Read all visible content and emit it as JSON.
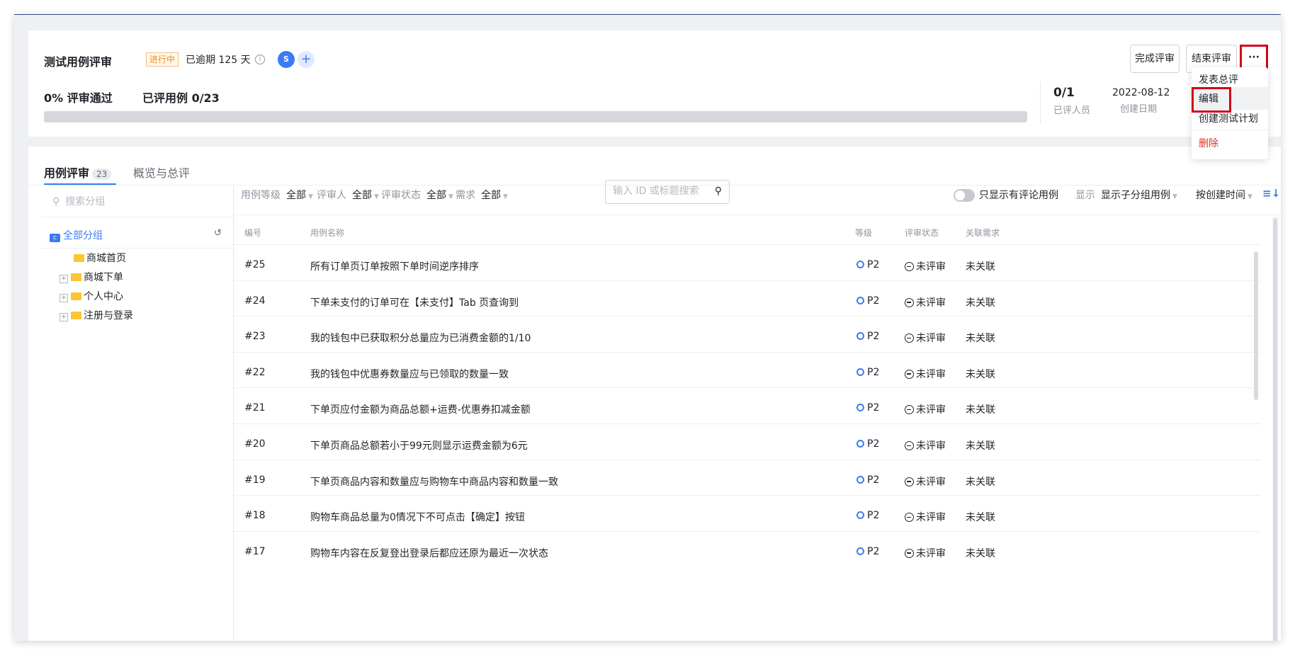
{
  "header": {
    "title": "测试用例评审",
    "status_tag": "进行中",
    "overdue": "已逾期 125 天",
    "info_icon": "i",
    "avatar_initial": "S",
    "add_member": "+",
    "pass_rate": "0% 评审通过",
    "reviewed_cases": "已评用例 0/23",
    "progress_fraction": 0,
    "reviewers_value": "0/1",
    "reviewers_label": "已评人员",
    "created_date": "2022-08-12",
    "created_label": "创建日期",
    "btn_complete": "完成评审",
    "btn_end": "结束评审",
    "btn_more": "···"
  },
  "menu": {
    "items": [
      "发表总评",
      "编辑",
      "创建测试计划",
      "删除"
    ],
    "delete_color": "#e0301e"
  },
  "tabs": {
    "case_review": "用例评审",
    "case_review_count": "23",
    "overview": "概览与总评"
  },
  "sidebar": {
    "search_placeholder": "搜索分组",
    "all_groups": "全部分组",
    "groups": [
      "商城首页",
      "商城下单",
      "个人中心",
      "注册与登录"
    ]
  },
  "filters": {
    "level_label": "用例等级",
    "level_value": "全部",
    "reviewer_label": "评审人",
    "reviewer_value": "全部",
    "status_label": "评审状态",
    "status_value": "全部",
    "req_label": "需求",
    "req_value": "全部",
    "search_placeholder": "输入 ID 或标题搜索",
    "only_comments": "只显示有评论用例",
    "display_label": "显示",
    "display_value": "显示子分组用例",
    "sort_value": "按创建时间"
  },
  "table": {
    "columns": [
      "编号",
      "用例名称",
      "等级",
      "评审状态",
      "关联需求"
    ],
    "rows": [
      {
        "id": "#25",
        "name": "所有订单页订单按照下单时间逆序排序",
        "level": "P2",
        "status": "未评审",
        "req": "未关联"
      },
      {
        "id": "#24",
        "name": "下单未支付的订单可在【未支付】Tab 页查询到",
        "level": "P2",
        "status": "未评审",
        "req": "未关联"
      },
      {
        "id": "#23",
        "name": "我的钱包中已获取积分总量应为已消费金额的1/10",
        "level": "P2",
        "status": "未评审",
        "req": "未关联"
      },
      {
        "id": "#22",
        "name": "我的钱包中优惠券数量应与已领取的数量一致",
        "level": "P2",
        "status": "未评审",
        "req": "未关联"
      },
      {
        "id": "#21",
        "name": "下单页应付金额为商品总额+运费-优惠券扣减金额",
        "level": "P2",
        "status": "未评审",
        "req": "未关联"
      },
      {
        "id": "#20",
        "name": "下单页商品总额若小于99元则显示运费金额为6元",
        "level": "P2",
        "status": "未评审",
        "req": "未关联"
      },
      {
        "id": "#19",
        "name": "下单页商品内容和数量应与购物车中商品内容和数量一致",
        "level": "P2",
        "status": "未评审",
        "req": "未关联"
      },
      {
        "id": "#18",
        "name": "购物车商品总量为0情况下不可点击【确定】按钮",
        "level": "P2",
        "status": "未评审",
        "req": "未关联"
      },
      {
        "id": "#17",
        "name": "购物车内容在反复登出登录后都应还原为最近一次状态",
        "level": "P2",
        "status": "未评审",
        "req": "未关联"
      }
    ]
  }
}
